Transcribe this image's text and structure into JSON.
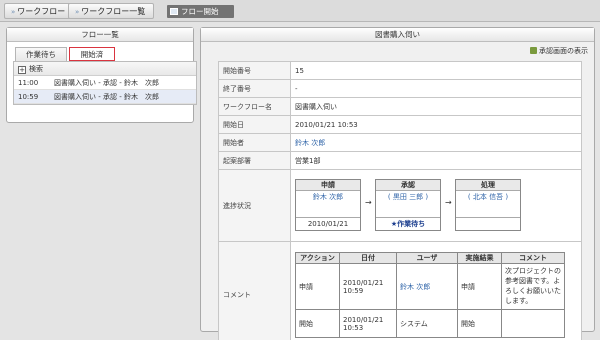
{
  "topbar": {
    "crumbs": [
      "ワークフロー",
      "ワークフロー一覧"
    ],
    "subtab": "フロー開始"
  },
  "left": {
    "title": "フロー一覧",
    "tabs": [
      "作業待ち",
      "開始済"
    ],
    "search": "検索",
    "rows": [
      {
        "time": "11:00",
        "text": "図書購入伺い - 承認 - 鈴木　次郎"
      },
      {
        "time": "10:59",
        "text": "図書購入伺い - 承認 - 鈴木　次郎"
      }
    ]
  },
  "right": {
    "title": "図書購入伺い",
    "approval_link": "承認画面の表示",
    "labels": {
      "number": "開始番号",
      "end_number": "終了番号",
      "workflow": "ワークフロー名",
      "start_date": "開始日",
      "starter": "開始者",
      "dept": "起案部署",
      "progress": "進捗状況",
      "comment": "コメント"
    },
    "values": {
      "number": "15",
      "end_number": "-",
      "workflow": "図書購入伺い",
      "start_date": "2010/01/21 10:53",
      "starter": "鈴木 次郎",
      "dept": "営業1部"
    },
    "steps": [
      {
        "title": "申請",
        "who": "鈴木 次郎",
        "footer": "2010/01/21"
      },
      {
        "title": "承認",
        "who": "( 黒田 三郎 )",
        "footer": "★作業待ち"
      },
      {
        "title": "処理",
        "who": "( 北本 信吾 )",
        "footer": ""
      }
    ],
    "step_arrow": "→",
    "comment_headers": [
      "アクション",
      "日付",
      "ユーザ",
      "実施結果",
      "コメント"
    ],
    "comments": [
      {
        "action": "申請",
        "date": "2010/01/21 10:59",
        "user": "鈴木 次郎",
        "result": "申請",
        "comment": "次プロジェクトの参考図書です。よろしくお願いいたします。"
      },
      {
        "action": "開始",
        "date": "2010/01/21 10:53",
        "user": "システム",
        "result": "開始",
        "comment": ""
      }
    ]
  },
  "colors": {
    "link": "#2f64a8",
    "selected_row": "#e6ebf6",
    "active_tab_border": "#d9343f"
  }
}
